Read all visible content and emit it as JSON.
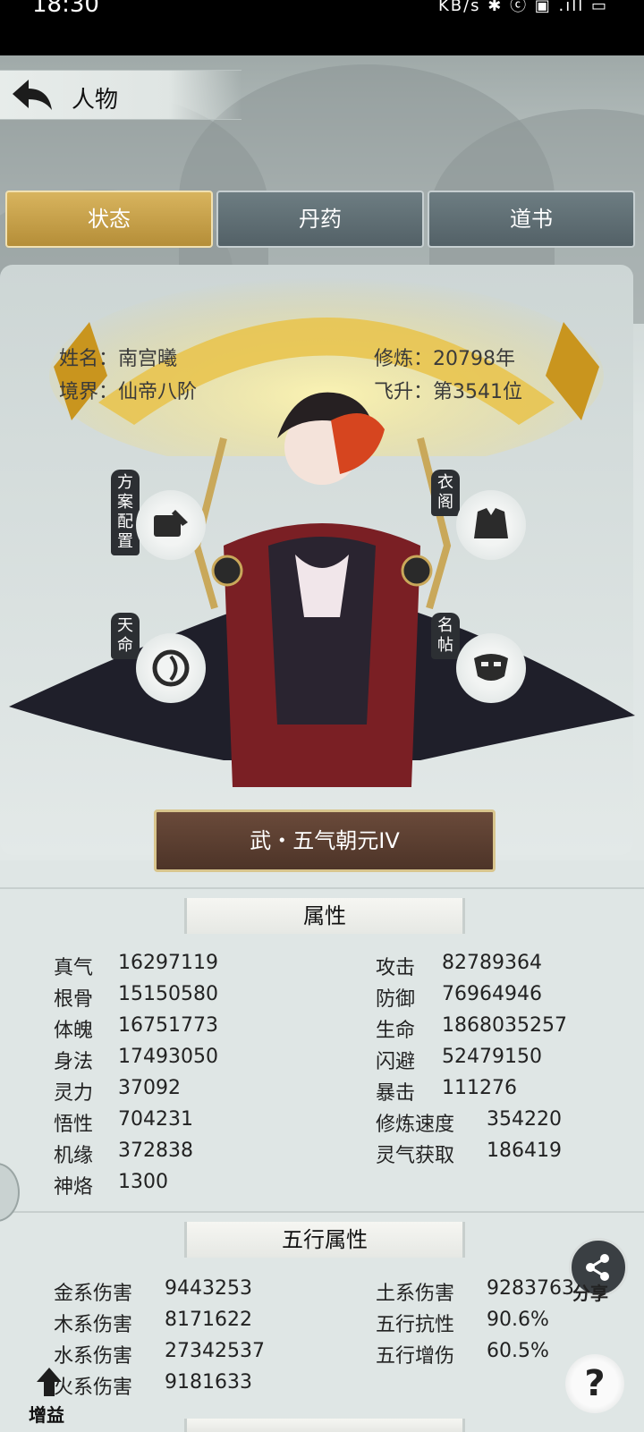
{
  "status_bar": {
    "time": "18:30",
    "icons": "KB/s ✱ ⓒ ▣ .ıll ▭"
  },
  "header": {
    "title": "人物"
  },
  "tabs": [
    {
      "label": "状态",
      "active": true
    },
    {
      "label": "丹药",
      "active": false
    },
    {
      "label": "道书",
      "active": false
    }
  ],
  "character": {
    "name_line": "姓名：南宫曦",
    "realm_line": "境界：仙帝八阶",
    "cultivation_line": "修炼：20798年",
    "ascension_line": "飞升：第3541位",
    "title": "武・五气朝元IV"
  },
  "side_buttons": {
    "plan": "方案配置",
    "wardrobe": "衣阁",
    "fate": "天命",
    "card": "名帖"
  },
  "attributes": {
    "header": "属性",
    "left": [
      {
        "label": "真气",
        "value": "16297119"
      },
      {
        "label": "根骨",
        "value": "15150580"
      },
      {
        "label": "体魄",
        "value": "16751773"
      },
      {
        "label": "身法",
        "value": "17493050"
      },
      {
        "label": "灵力",
        "value": "37092"
      },
      {
        "label": "悟性",
        "value": "704231"
      },
      {
        "label": "机缘",
        "value": "372838"
      },
      {
        "label": "神烙",
        "value": "1300"
      }
    ],
    "right": [
      {
        "label": "攻击",
        "value": "82789364"
      },
      {
        "label": "防御",
        "value": "76964946"
      },
      {
        "label": "生命",
        "value": "1868035257"
      },
      {
        "label": "闪避",
        "value": "52479150"
      },
      {
        "label": "暴击",
        "value": "111276"
      },
      {
        "label": "修炼速度",
        "value": "354220"
      },
      {
        "label": "灵气获取",
        "value": "186419"
      }
    ]
  },
  "elements": {
    "header": "五行属性",
    "left": [
      {
        "label": "金系伤害",
        "value": "9443253"
      },
      {
        "label": "木系伤害",
        "value": "8171622"
      },
      {
        "label": "水系伤害",
        "value": "27342537"
      },
      {
        "label": "火系伤害",
        "value": "9181633"
      }
    ],
    "right": [
      {
        "label": "土系伤害",
        "value": "9283763"
      },
      {
        "label": "五行抗性",
        "value": "90.6%"
      },
      {
        "label": "五行增伤",
        "value": "60.5%"
      }
    ]
  },
  "floating": {
    "share": "分享",
    "buff": "增益",
    "help": "?"
  },
  "colors": {
    "tab_active": "#c9a24a",
    "tab_inactive": "#5f6e73",
    "plate": "#5b3f31"
  }
}
